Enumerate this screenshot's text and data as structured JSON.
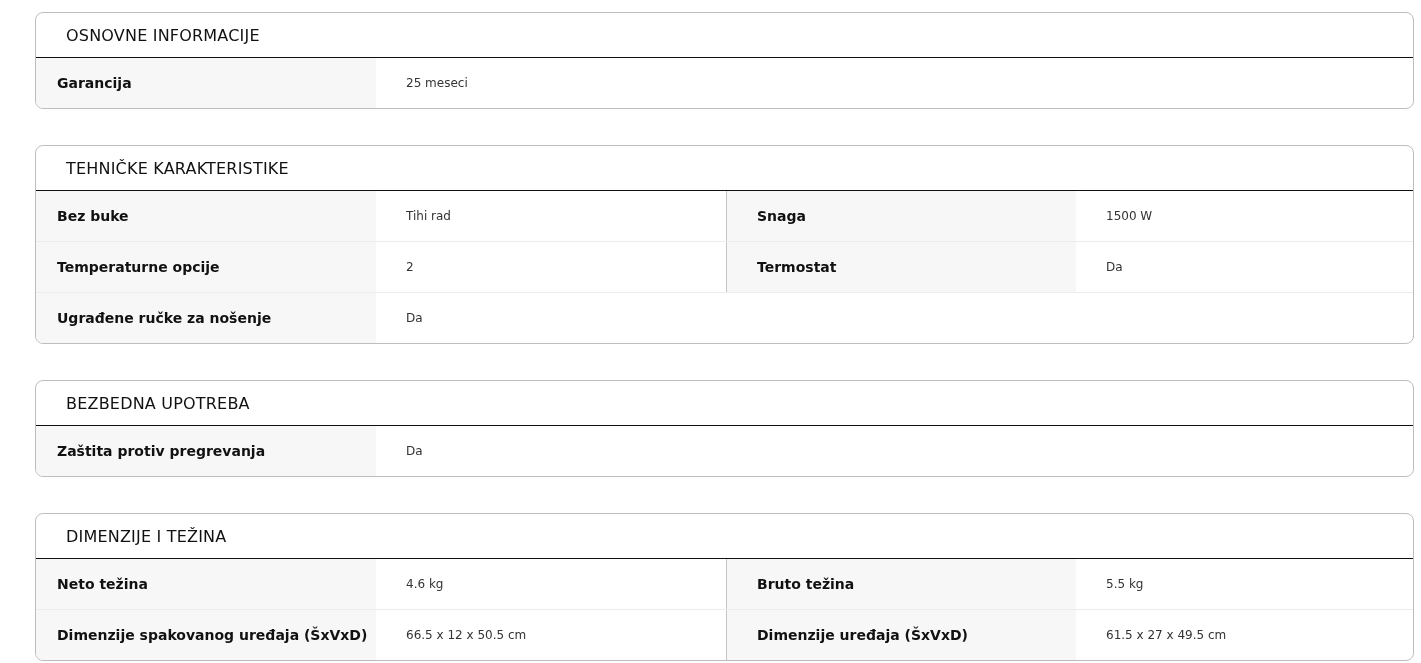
{
  "sections": [
    {
      "title": "OSNOVNE INFORMACIJE",
      "rows": [
        [
          {
            "label": "Garancija",
            "value": "25 meseci"
          }
        ]
      ]
    },
    {
      "title": "TEHNIČKE KARAKTERISTIKE",
      "rows": [
        [
          {
            "label": "Bez buke",
            "value": "Tihi rad"
          },
          {
            "label": "Snaga",
            "value": "1500 W"
          }
        ],
        [
          {
            "label": "Temperaturne opcije",
            "value": "2"
          },
          {
            "label": "Termostat",
            "value": "Da"
          }
        ],
        [
          {
            "label": "Ugrađene ručke za nošenje",
            "value": "Da"
          }
        ]
      ]
    },
    {
      "title": "BEZBEDNA UPOTREBA",
      "rows": [
        [
          {
            "label": "Zaštita protiv pregrevanja",
            "value": "Da"
          }
        ]
      ]
    },
    {
      "title": "DIMENZIJE I TEŽINA",
      "rows": [
        [
          {
            "label": "Neto težina",
            "value": "4.6 kg"
          },
          {
            "label": "Bruto težina",
            "value": "5.5 kg"
          }
        ],
        [
          {
            "label": "Dimenzije spakovanog uređaja (ŠxVxD)",
            "value": "66.5 x 12 x 50.5 cm"
          },
          {
            "label": "Dimenzije uređaja (ŠxVxD)",
            "value": "61.5 x 27 x 49.5 cm"
          }
        ]
      ]
    }
  ]
}
